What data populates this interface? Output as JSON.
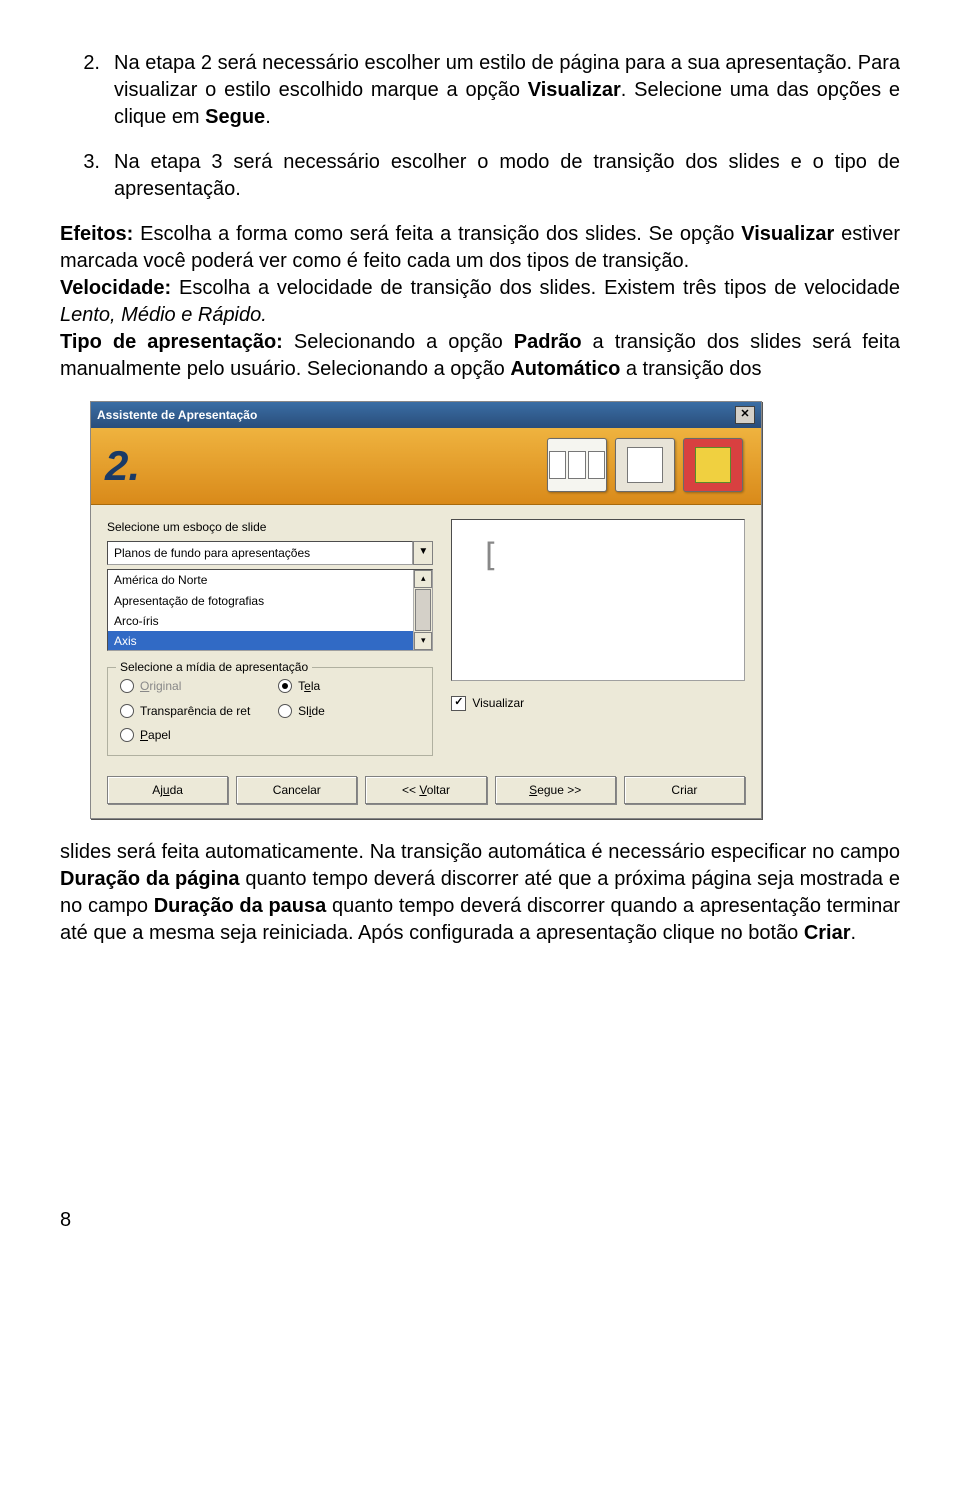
{
  "step2": {
    "num": "2.",
    "text_before": "Na etapa 2 será necessário escolher um estilo de página para a sua apresentação. Para visualizar o estilo escolhido marque a opção ",
    "bold1": "Visualizar",
    "text_mid": ". Selecione uma das opções e clique em ",
    "bold2": "Segue",
    "text_end": "."
  },
  "step3": {
    "num": "3.",
    "text": "Na etapa 3 será necessário escolher o modo de transição dos slides e o tipo de apresentação."
  },
  "efeitos": {
    "label": "Efeitos:",
    "text1": " Escolha a forma como será feita a transição dos slides. Se opção ",
    "bold1": "Visualizar",
    "text2": " estiver marcada você poderá ver como é feito cada um dos tipos de transição."
  },
  "velocidade": {
    "label": "Velocidade:",
    "text1": " Escolha a velocidade de transição dos slides. Existem três tipos de velocidade ",
    "italic": "Lento, Médio e Rápido.",
    "text2": ""
  },
  "tipo": {
    "label": "Tipo de apresentação:",
    "text1": " Selecionando a opção ",
    "bold1": "Padrão",
    "text2": " a transição dos slides será feita manualmente pelo usuário. Selecionando a opção ",
    "bold2": "Automático",
    "text3": " a transição dos"
  },
  "after": {
    "text1": "slides será feita automaticamente. Na transição automática é necessário especificar no campo ",
    "bold1": "Duração da página",
    "text2": " quanto tempo deverá discorrer até que a próxima página seja mostrada e no campo ",
    "bold2": "Duração da pausa",
    "text3": " quanto tempo deverá discorrer quando a apresentação terminar até que a mesma seja reiniciada. Após configurada a apresentação clique no botão ",
    "bold3": "Criar",
    "text4": "."
  },
  "dialog": {
    "title": "Assistente de Apresentação",
    "step": "2.",
    "group1_label": "Selecione um esboço de slide",
    "dropdown_value": "Planos de fundo para apresentações",
    "list": [
      "América do Norte",
      "Apresentação de fotografias",
      "Arco-íris",
      "Axis"
    ],
    "selected_index": 3,
    "group2_label": "Selecione a mídia de apresentação",
    "radios": {
      "original": "Original",
      "tela": "Tela",
      "transparencia": "Transparência de ret",
      "slide": "Slide",
      "papel": "Papel"
    },
    "visualizar": "Visualizar",
    "buttons": {
      "ajuda": "Ajuda",
      "cancelar": "Cancelar",
      "voltar": "<< Voltar",
      "segue": "Segue >>",
      "criar": "Criar"
    }
  },
  "page_number": "8"
}
